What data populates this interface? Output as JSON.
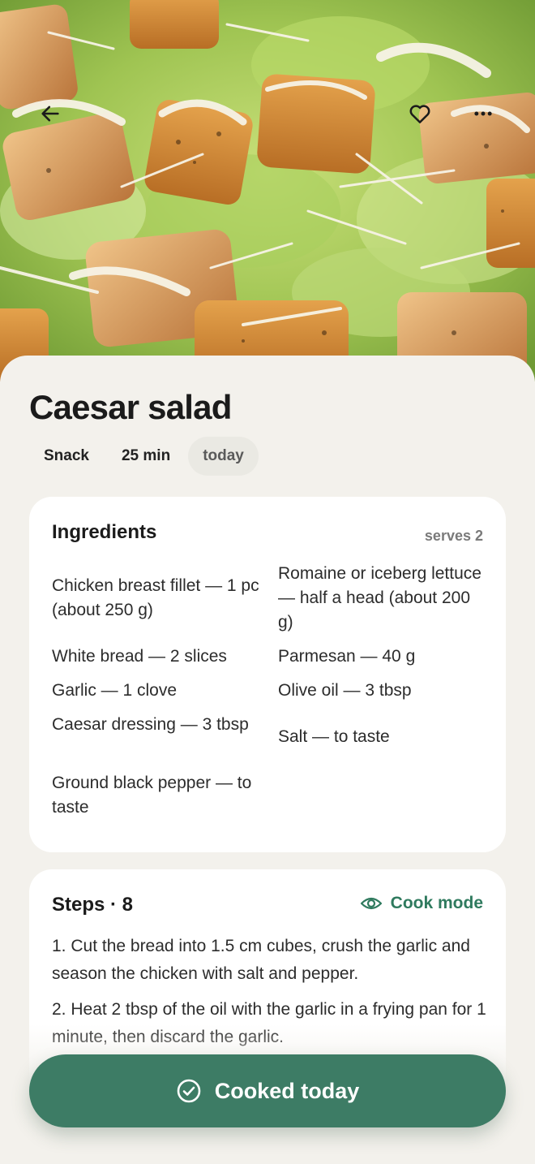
{
  "hero": {
    "back_icon": "arrow-left-icon",
    "favorite_icon": "heart-outline-icon",
    "more_icon": "more-horizontal-icon"
  },
  "recipe": {
    "title": "Caesar salad",
    "chips": [
      "Snack",
      "25 min",
      "today"
    ]
  },
  "ingredients": {
    "title": "Ingredients",
    "serves": "serves 2",
    "left": [
      "Chicken breast fillet — 1 pc (about 250 g)",
      "White bread — 2 slices",
      "Garlic — 1 clove",
      "Caesar dressing — 3 tbsp",
      "Ground black pepper — to taste"
    ],
    "right": [
      "Romaine or iceberg lettuce — half a head (about 200 g)",
      "Parmesan — 40 g",
      "Olive oil — 3 tbsp",
      "Salt — to taste"
    ]
  },
  "steps": {
    "title": "Steps · 8",
    "cook_mode_label": "Cook mode",
    "cook_mode_icon": "eye-icon",
    "items": [
      "1. Cut the bread into 1.5 cm cubes, crush the garlic and season the chicken with salt and pepper.",
      "2. Heat 2 tbsp of the oil with the garlic in a frying pan for 1 minute, then discard the garlic."
    ]
  },
  "cta": {
    "label": "Cooked today",
    "icon": "check-circle-icon"
  },
  "colors": {
    "accent": "#3d7c65",
    "accent_text": "#2f7a5e",
    "background": "#f3f1ec",
    "card": "#ffffff"
  }
}
